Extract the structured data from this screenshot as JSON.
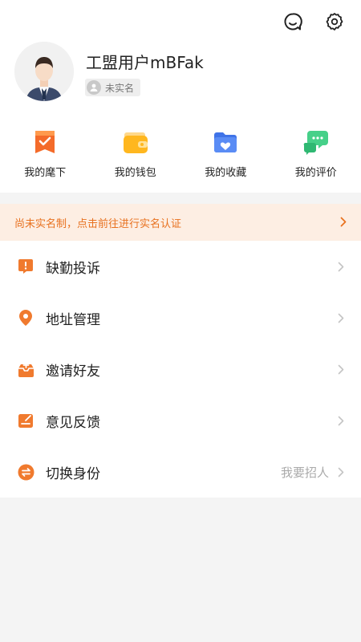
{
  "profile": {
    "username": "工盟用户mBFak",
    "verify_badge": "未实名"
  },
  "quick_links": [
    {
      "label": "我的麾下",
      "icon": "team-flag-icon"
    },
    {
      "label": "我的钱包",
      "icon": "wallet-icon"
    },
    {
      "label": "我的收藏",
      "icon": "favorites-folder-icon"
    },
    {
      "label": "我的评价",
      "icon": "review-chat-icon"
    }
  ],
  "notice": {
    "text": "尚未实名制，点击前往进行实名认证"
  },
  "menu": [
    {
      "label": "缺勤投诉",
      "icon": "complaint-icon",
      "hint": ""
    },
    {
      "label": "地址管理",
      "icon": "location-pin-icon",
      "hint": ""
    },
    {
      "label": "邀请好友",
      "icon": "invite-icon",
      "hint": ""
    },
    {
      "label": "意见反馈",
      "icon": "feedback-edit-icon",
      "hint": ""
    },
    {
      "label": "切换身份",
      "icon": "switch-identity-icon",
      "hint": "我要招人"
    }
  ],
  "colors": {
    "accent": "#f07a2e",
    "notice_bg": "#fdeee3",
    "notice_text": "#e8711f"
  }
}
